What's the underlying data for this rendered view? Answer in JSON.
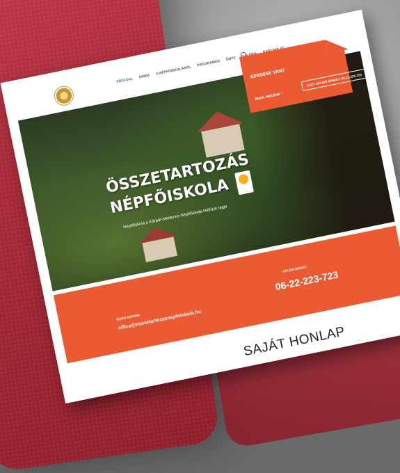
{
  "nav": {
    "items": [
      "FŐOLDAL",
      "HÍREK",
      "A NÉPFŐISKOLÁRÓL",
      "PROGRAMOK",
      "ÜNTS",
      "GALÉRIA",
      "KAPCSOLAT"
    ]
  },
  "contact": {
    "question": "KÉRDÉSE VAN?",
    "write_us": "ÍRJON NEKÜNK  ›",
    "call_us": "VAGY HÍVJON MINKET: 06-22-223-723"
  },
  "hero": {
    "title_line1": "ÖSSZETARTOZÁS",
    "title_line2": "NÉPFŐISKOLA",
    "subtitle": "Népfőiskola a Kárpát-Medence Népfőiskola Hálózat tagja"
  },
  "band": {
    "email_label": "ÍRJON NEKÜNK",
    "email": "office@osszetartozasnepfoiskola.hu",
    "phone_label": "HÍVJON MINKET",
    "phone": "06-22-223-723"
  },
  "caption": "SAJÁT HONLAP",
  "colors": {
    "accent": "#ea5a33",
    "link": "#2a72c9"
  }
}
